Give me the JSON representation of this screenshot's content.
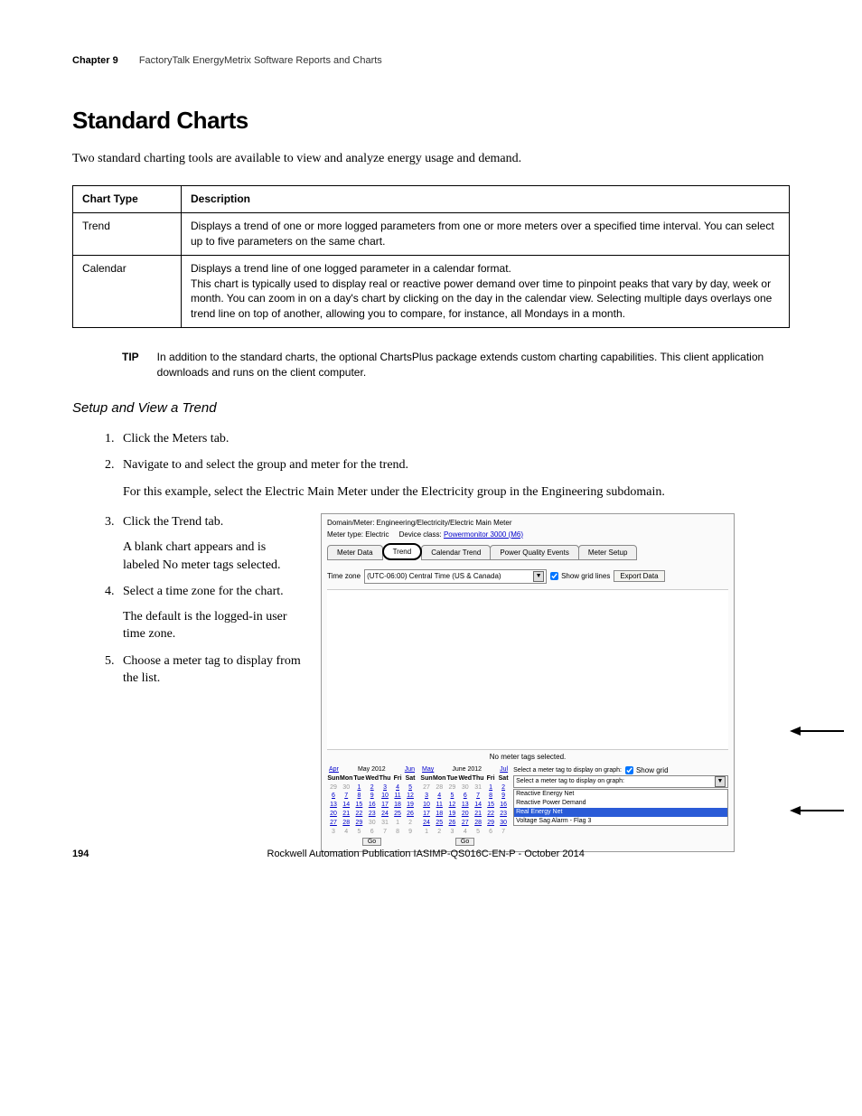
{
  "header": {
    "chapter": "Chapter 9",
    "title": "FactoryTalk EnergyMetrix Software Reports and Charts"
  },
  "h1": "Standard Charts",
  "intro": "Two standard charting tools are available to view and analyze energy usage and demand.",
  "table": {
    "col1": "Chart Type",
    "col2": "Description",
    "rows": [
      {
        "type": "Trend",
        "desc": "Displays a trend of one or more logged parameters from one or more meters over a specified time interval. You can select up to five parameters on the same chart."
      },
      {
        "type": "Calendar",
        "desc_line1": "Displays a trend line of one logged parameter in a calendar format.",
        "desc_line2": "This chart is typically used to display real or reactive power demand over time to pinpoint peaks that vary by day, week or month. You can zoom in on a day's chart by clicking on the day in the calendar view. Selecting multiple days overlays one trend line on top of another, allowing you to compare, for instance, all Mondays in a month."
      }
    ]
  },
  "tip": {
    "label": "TIP",
    "text": "In addition to the standard charts, the optional ChartsPlus package extends custom charting capabilities. This client application downloads and runs on the client computer."
  },
  "h2": "Setup and View a Trend",
  "steps": {
    "s1": "Click the Meters tab.",
    "s2": "Navigate to and select the group and meter for the trend.",
    "s2_follow": "For this example, select the Electric Main Meter under the Electricity group in the Engineering subdomain.",
    "s3": "Click the Trend tab.",
    "s3_follow": "A blank chart appears and is labeled No meter tags selected.",
    "s4": "Select a time zone for the chart.",
    "s4_follow": "The default is the logged-in user time zone.",
    "s5": "Choose a meter tag to display from the list."
  },
  "screenshot": {
    "breadcrumb": "Domain/Meter: Engineering/Electricity/Electric Main Meter",
    "meter_type_label": "Meter type: Electric",
    "device_class_label": "Device class: ",
    "device_class_link": "Powermonitor 3000 (M6)",
    "tabs": [
      "Meter Data",
      "Trend",
      "Calendar Trend",
      "Power Quality Events",
      "Meter Setup"
    ],
    "active_tab": "Trend",
    "tz_label": "Time zone",
    "tz_value": "(UTC-06:00) Central Time (US & Canada)",
    "show_grid": "Show grid lines",
    "export": "Export Data",
    "no_tags": "No meter tags selected.",
    "cal1": {
      "prev": "Apr",
      "title": "May 2012",
      "next": "Jun",
      "dow": [
        "Sun",
        "Mon",
        "Tue",
        "Wed",
        "Thu",
        "Fri",
        "Sat"
      ],
      "weeks": [
        [
          "29",
          "30",
          "1",
          "2",
          "3",
          "4",
          "5"
        ],
        [
          "6",
          "7",
          "8",
          "9",
          "10",
          "11",
          "12"
        ],
        [
          "13",
          "14",
          "15",
          "16",
          "17",
          "18",
          "19"
        ],
        [
          "20",
          "21",
          "22",
          "23",
          "24",
          "25",
          "26"
        ],
        [
          "27",
          "28",
          "29",
          "30",
          "31",
          "1",
          "2"
        ],
        [
          "3",
          "4",
          "5",
          "6",
          "7",
          "8",
          "9"
        ]
      ],
      "out_first": 2,
      "out_last_start": 32
    },
    "cal2": {
      "prev": "May",
      "title": "June 2012",
      "next": "Jul",
      "dow": [
        "Sun",
        "Mon",
        "Tue",
        "Wed",
        "Thu",
        "Fri",
        "Sat"
      ],
      "weeks": [
        [
          "27",
          "28",
          "29",
          "30",
          "31",
          "1",
          "2"
        ],
        [
          "3",
          "4",
          "5",
          "6",
          "7",
          "8",
          "9"
        ],
        [
          "10",
          "11",
          "12",
          "13",
          "14",
          "15",
          "16"
        ],
        [
          "17",
          "18",
          "19",
          "20",
          "21",
          "22",
          "23"
        ],
        [
          "24",
          "25",
          "26",
          "27",
          "28",
          "29",
          "30"
        ],
        [
          "1",
          "2",
          "3",
          "4",
          "5",
          "6",
          "7"
        ]
      ],
      "out_first": 5,
      "out_last_start": 36
    },
    "go": "Go",
    "tag_label": "Select a meter tag to display on graph:",
    "tag_placeholder": "Select a meter tag to display on graph:",
    "tags": [
      "Reactive Energy Net",
      "Reactive Power Demand",
      "Real Energy Net",
      "Voltage Sag Alarm - Flag 3"
    ],
    "tag_sel_idx": 2,
    "show_grid2": "Show grid"
  },
  "footer": {
    "page": "194",
    "pub": "Rockwell Automation Publication IASIMP-QS016C-EN-P - October 2014"
  }
}
